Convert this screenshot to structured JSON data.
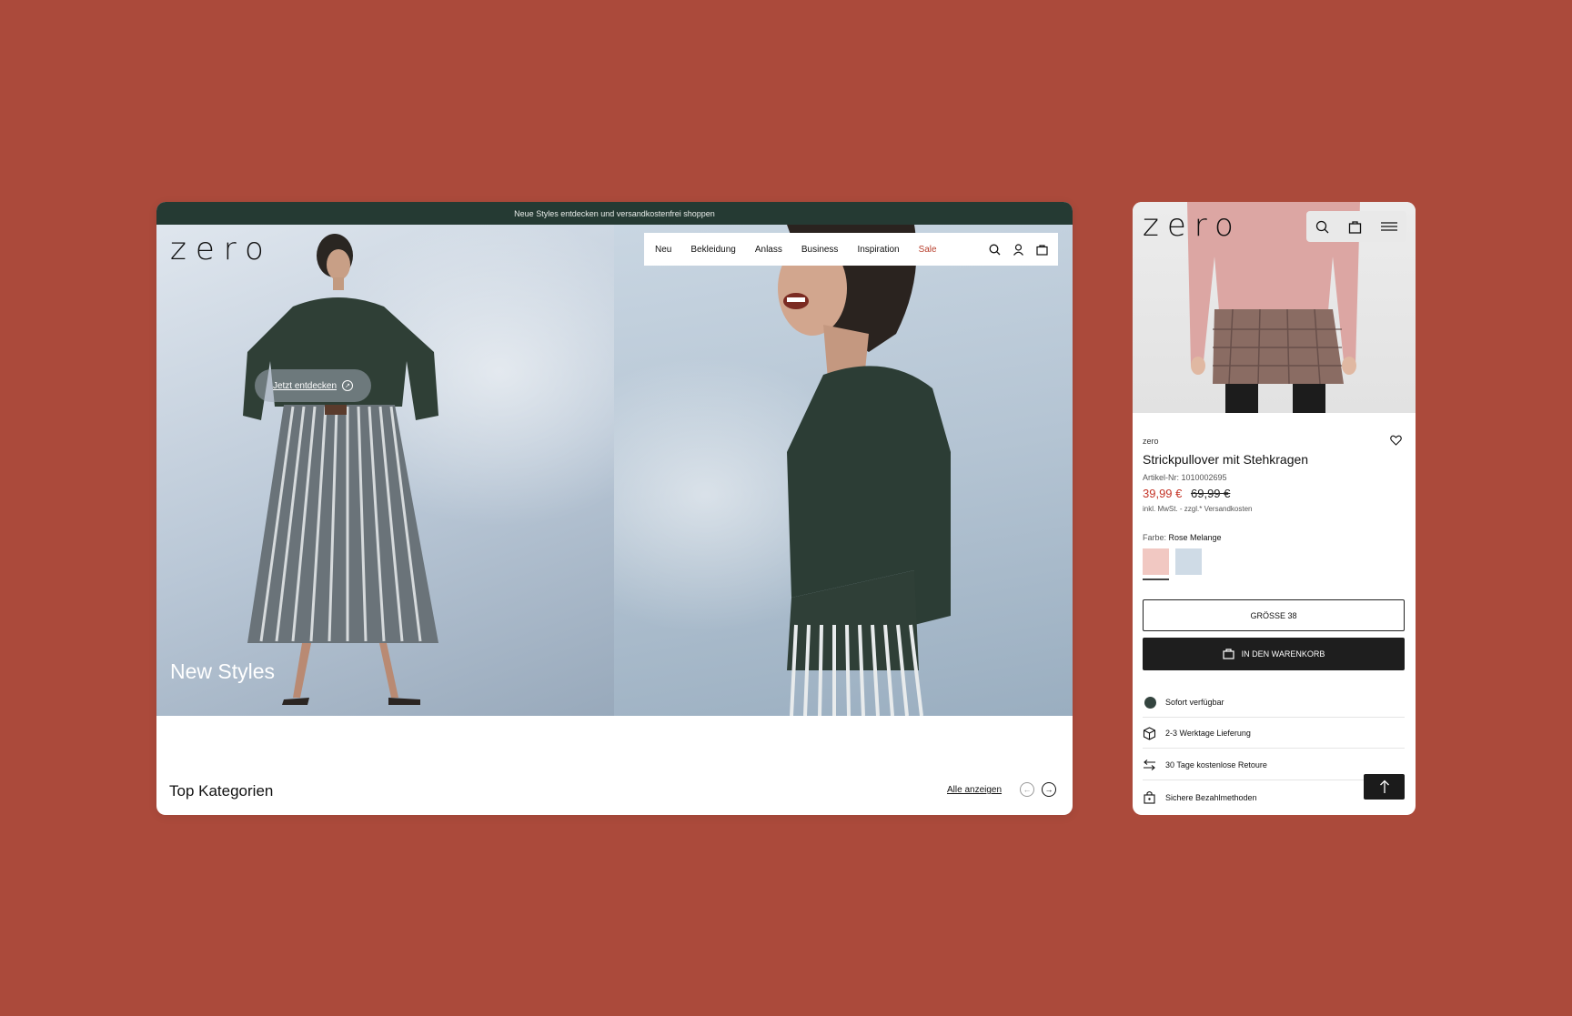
{
  "desktop": {
    "promo_text": "Neue Styles entdecken und versandkostenfrei shoppen",
    "logo": "zero",
    "nav": {
      "items": [
        "Neu",
        "Bekleidung",
        "Anlass",
        "Business",
        "Inspiration",
        "Sale"
      ],
      "icons": [
        "search-icon",
        "user-icon",
        "bag-icon"
      ]
    },
    "hero": {
      "cta_label": "Jetzt entdecken",
      "headline": "New Styles"
    },
    "section": {
      "title": "Top Kategorien",
      "view_all": "Alle anzeigen"
    }
  },
  "mobile": {
    "logo": "zero",
    "header_icons": [
      "search-icon",
      "bag-icon",
      "menu-icon"
    ],
    "product": {
      "brand": "zero",
      "title": "Strickpullover mit Stehkragen",
      "sku": "Artikel-Nr: 1010002695",
      "price_new": "39,99 €",
      "price_old": "69,99 €",
      "tax_note": "inkl. MwSt. - zzgl.* Versandkosten",
      "color_label": "Farbe:",
      "color_value": "Rose Melange",
      "swatch_colors": [
        "#f1c8c2",
        "#cfdbe6"
      ],
      "size_button": "GRÖSSE 38",
      "cart_button": "IN DEN WARENKORB"
    },
    "features": [
      "Sofort verfügbar",
      "2-3 Werktage Lieferung",
      "30 Tage kostenlose Retoure",
      "Sichere Bezahlmethoden"
    ]
  },
  "colors": {
    "background": "#ab4a3b",
    "promo_bar": "#253a33",
    "sale": "#b8412f",
    "price_new": "#c43427"
  }
}
